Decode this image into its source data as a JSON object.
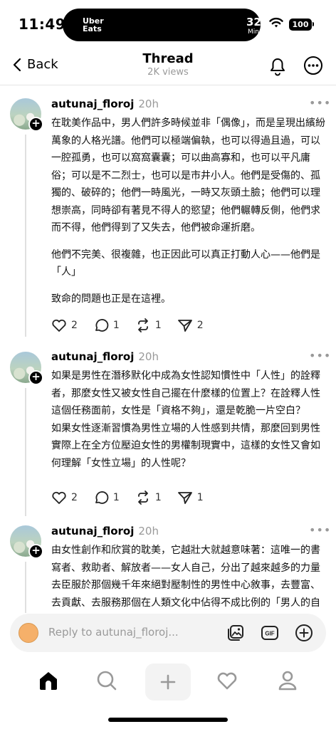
{
  "status_bar": {
    "time": "11:49",
    "live_activity": {
      "app_line1": "Uber",
      "app_line2": "Eats",
      "eta_value": "32",
      "eta_unit": "Min"
    },
    "battery": "100"
  },
  "nav": {
    "back_label": "Back",
    "title": "Thread",
    "views": "2K views"
  },
  "posts": [
    {
      "username": "autunaj_floroj",
      "timestamp": "20h",
      "paragraphs": [
        "在耽美作品中，男人們許多時候並非「偶像」，而是呈現出繽紛萬象的人格光譜。他們可以極端偏執，也可以得過且過，可以一腔孤勇，也可以窩窩囊囊；可以曲高寡和，也可以平凡庸俗；可以是不二烈士，也可以是市井小人。他們是受傷的、孤獨的、破碎的；他們一時風光，一時又灰頭土臉；他們可以理想崇高，同時卻有著見不得人的慾望；他們輾轉反側，他們求而不得，他們得到了又失去，他們被命運折磨。",
        "他們不完美、很複雜，也正因此可以真正打動人心——他們是「人」",
        "致命的問題也正是在這裡。"
      ],
      "likes": "2",
      "replies": "1",
      "reposts": "1",
      "shares": "2"
    },
    {
      "username": "autunaj_floroj",
      "timestamp": "20h",
      "paragraphs": [
        "如果是男性在潛移默化中成為女性認知慣性中「人性」的詮釋者，那麼女性又被女性自己擺在什麼樣的位置上？在詮釋人性這個任務面前，女性是「資格不夠」，還是乾脆一片空白？",
        "如果女性逐漸習慣為男性立場的人性感到共情，那麼回到男性實際上在全方位壓迫女性的男權制現實中，這樣的女性又會如何理解「女性立場」的人性呢？"
      ],
      "likes": "2",
      "replies": "1",
      "reposts": "1",
      "shares": "1"
    },
    {
      "username": "autunaj_floroj",
      "timestamp": "20h",
      "paragraphs": [
        "由女性創作和欣賞的耽美，它越壯大就越意味著：這唯一的書寫者、救助者、解放者——女人自己，分出了越來越多的力量去臣服於那個幾千年來絕對壓制性的男性中心敘事，去豐富、去貢獻、去服務那個在人類文化中佔得不成比例的「男人的自我內涵話語」在這個性別中，"
      ]
    }
  ],
  "reply_bar": {
    "placeholder": "Reply to autunaj_floroj..."
  },
  "tab_bar": {
    "items": [
      "home-icon",
      "search-icon",
      "add-icon",
      "heart-icon",
      "profile-icon"
    ]
  },
  "icons": {
    "post_actions": [
      "heart-icon",
      "comment-icon",
      "repost-icon",
      "share-icon"
    ],
    "reply_bar": [
      "image-icon",
      "gif-icon",
      "add-circle-icon"
    ]
  },
  "colors": {
    "muted": "#999999",
    "accent": "#000000"
  }
}
